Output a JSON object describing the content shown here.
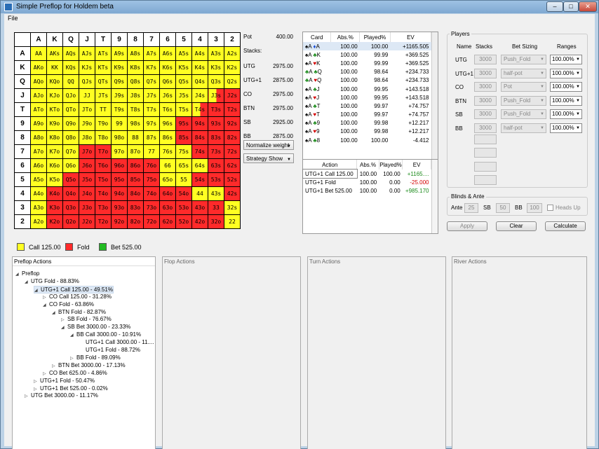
{
  "window": {
    "title": "Simple Preflop for Holdem beta",
    "min": "–",
    "max": "□",
    "close": "✕"
  },
  "menu": {
    "file": "File"
  },
  "hand_matrix": {
    "headers": [
      "A",
      "K",
      "Q",
      "J",
      "T",
      "9",
      "8",
      "7",
      "6",
      "5",
      "4",
      "3",
      "2"
    ],
    "rows": [
      [
        "AA",
        "AKs",
        "AQs",
        "AJs",
        "ATs",
        "A9s",
        "A8s",
        "A7s",
        "A6s",
        "A5s",
        "A4s",
        "A3s",
        "A2s"
      ],
      [
        "AKo",
        "KK",
        "KQs",
        "KJs",
        "KTs",
        "K9s",
        "K8s",
        "K7s",
        "K6s",
        "K5s",
        "K4s",
        "K3s",
        "K2s"
      ],
      [
        "AQo",
        "KQo",
        "QQ",
        "QJs",
        "QTs",
        "Q9s",
        "Q8s",
        "Q7s",
        "Q6s",
        "Q5s",
        "Q4s",
        "Q3s",
        "Q2s"
      ],
      [
        "AJo",
        "KJo",
        "QJo",
        "JJ",
        "JTs",
        "J9s",
        "J8s",
        "J7s",
        "J6s",
        "J5s",
        "J4s",
        "J3s",
        "J2s"
      ],
      [
        "ATo",
        "KTo",
        "QTo",
        "JTo",
        "TT",
        "T9s",
        "T8s",
        "T7s",
        "T6s",
        "T5s",
        "T4s",
        "T3s",
        "T2s"
      ],
      [
        "A9o",
        "K9o",
        "Q9o",
        "J9o",
        "T9o",
        "99",
        "98s",
        "97s",
        "96s",
        "95s",
        "94s",
        "93s",
        "92s"
      ],
      [
        "A8o",
        "K8o",
        "Q8o",
        "J8o",
        "T8o",
        "98o",
        "88",
        "87s",
        "86s",
        "85s",
        "84s",
        "83s",
        "82s"
      ],
      [
        "A7o",
        "K7o",
        "Q7o",
        "J7o",
        "T7o",
        "97o",
        "87o",
        "77",
        "76s",
        "75s",
        "74s",
        "73s",
        "72s"
      ],
      [
        "A6o",
        "K6o",
        "Q6o",
        "J6o",
        "T6o",
        "96o",
        "86o",
        "76o",
        "66",
        "65s",
        "64s",
        "63s",
        "62s"
      ],
      [
        "A5o",
        "K5o",
        "Q5o",
        "J5o",
        "T5o",
        "95o",
        "85o",
        "75o",
        "65o",
        "55",
        "54s",
        "53s",
        "52s"
      ],
      [
        "A4o",
        "K4o",
        "Q4o",
        "J4o",
        "T4o",
        "94o",
        "84o",
        "74o",
        "64o",
        "54o",
        "44",
        "43s",
        "42s"
      ],
      [
        "A3o",
        "K3o",
        "Q3o",
        "J3o",
        "T3o",
        "93o",
        "83o",
        "73o",
        "63o",
        "53o",
        "43o",
        "33",
        "32s"
      ],
      [
        "A2o",
        "K2o",
        "Q2o",
        "J2o",
        "T2o",
        "92o",
        "82o",
        "72o",
        "62o",
        "52o",
        "42o",
        "32o",
        "22"
      ]
    ],
    "colors": [
      "ccccccccccccc",
      "ccccccccccccc",
      "ccccccccccccc",
      "cccccccccccsf",
      "ccccccccccsff",
      "cccccccccffff",
      "cccccccccffff",
      "cccffcccccfff",
      "cccfffffcccff",
      "ccffffffccfff",
      "cfffffffffccf",
      "cfffffffffffc",
      "cfffffffffffc"
    ],
    "call_color": "#ffff22",
    "fold_color": "#ff2a2a",
    "bet_color": "#22bb22"
  },
  "legend": [
    {
      "label": "Call 125.00",
      "color": "#ffff22"
    },
    {
      "label": "Fold",
      "color": "#ff2a2a"
    },
    {
      "label": "Bet 525.00",
      "color": "#22bb22"
    }
  ],
  "pot": {
    "label": "Pot",
    "value": "400.00",
    "stacks_label": "Stacks:"
  },
  "stacks": [
    {
      "pos": "UTG",
      "value": "2975.00"
    },
    {
      "pos": "UTG+1",
      "value": "2875.00"
    },
    {
      "pos": "CO",
      "value": "2975.00"
    },
    {
      "pos": "BTN",
      "value": "2975.00"
    },
    {
      "pos": "SB",
      "value": "2925.00"
    },
    {
      "pos": "BB",
      "value": "2875.00"
    }
  ],
  "normalize_select": "Normalize weight",
  "strategy_select": "Strategy Show",
  "card_table": {
    "headers": [
      "Card",
      "Abs.%",
      "Played%",
      "EV"
    ],
    "rows": [
      {
        "card": "♠A ♦A",
        "abs": "100.00",
        "played": "100.00",
        "ev": "+1165.505"
      },
      {
        "card": "♠A ♣K",
        "abs": "100.00",
        "played": "99.99",
        "ev": "+369.525"
      },
      {
        "card": "♠A ♥K",
        "abs": "100.00",
        "played": "99.99",
        "ev": "+369.525"
      },
      {
        "card": "♣A ♣Q",
        "abs": "100.00",
        "played": "98.64",
        "ev": "+234.733"
      },
      {
        "card": "♣A ♥Q",
        "abs": "100.00",
        "played": "98.64",
        "ev": "+234.733"
      },
      {
        "card": "♠A ♣J",
        "abs": "100.00",
        "played": "99.95",
        "ev": "+143.518"
      },
      {
        "card": "♠A ♥J",
        "abs": "100.00",
        "played": "99.95",
        "ev": "+143.518"
      },
      {
        "card": "♠A ♣T",
        "abs": "100.00",
        "played": "99.97",
        "ev": "+74.757"
      },
      {
        "card": "♠A ♥T",
        "abs": "100.00",
        "played": "99.97",
        "ev": "+74.757"
      },
      {
        "card": "♠A ♣9",
        "abs": "100.00",
        "played": "99.98",
        "ev": "+12.217"
      },
      {
        "card": "♠A ♥9",
        "abs": "100.00",
        "played": "99.98",
        "ev": "+12.217"
      },
      {
        "card": "♠A ♣8",
        "abs": "100.00",
        "played": "100.00",
        "ev": "-4.412"
      }
    ]
  },
  "action_table": {
    "headers": [
      "Action",
      "Abs.%",
      "Played%",
      "EV"
    ],
    "rows": [
      {
        "action": "UTG+1 Call 125.00",
        "abs": "100.00",
        "played": "100.00",
        "ev": "+1165....",
        "evc": "#1a8a1a"
      },
      {
        "action": "UTG+1 Fold",
        "abs": "100.00",
        "played": "0.00",
        "ev": "-25.000",
        "evc": "#d40000"
      },
      {
        "action": "UTG+1 Bet 525.00",
        "abs": "100.00",
        "played": "0.00",
        "ev": "+985.170",
        "evc": "#1a8a1a"
      }
    ]
  },
  "players": {
    "group_label": "Players",
    "headers": [
      "Name",
      "Stacks",
      "Bet Sizing",
      "Ranges"
    ],
    "rows": [
      {
        "name": "UTG",
        "stack": "3000",
        "sizing": "Push_Fold",
        "range": "100.00%"
      },
      {
        "name": "UTG+1",
        "stack": "3000",
        "sizing": "half-pot",
        "range": "100.00%"
      },
      {
        "name": "CO",
        "stack": "3000",
        "sizing": "Pot",
        "range": "100.00%"
      },
      {
        "name": "BTN",
        "stack": "3000",
        "sizing": "Push_Fold",
        "range": "100.00%"
      },
      {
        "name": "SB",
        "stack": "3000",
        "sizing": "Push_Fold",
        "range": "100.00%"
      },
      {
        "name": "BB",
        "stack": "3000",
        "sizing": "half-pot",
        "range": "100.00%"
      }
    ]
  },
  "blinds": {
    "group_label": "Blinds & Ante",
    "ante_label": "Ante",
    "ante": "25",
    "sb_label": "SB",
    "sb": "50",
    "bb_label": "BB",
    "bb": "100",
    "heads_up": "Heads Up"
  },
  "buttons": {
    "apply": "Apply",
    "clear": "Clear",
    "calculate": "Calculate"
  },
  "panels": {
    "preflop": "Preflop Actions",
    "flop": "Flop Actions",
    "turn": "Turn Actions",
    "river": "River Actions"
  },
  "tree": [
    {
      "text": "Preflop",
      "indent": 0,
      "icon": "◢"
    },
    {
      "text": "UTG Fold - 88.83%",
      "indent": 1,
      "icon": "◢"
    },
    {
      "text": "UTG+1 Call 125.00 - 49.51%",
      "indent": 2,
      "icon": "◢",
      "selected": true
    },
    {
      "text": "CO Call 125.00 - 31.28%",
      "indent": 3,
      "icon": "▷"
    },
    {
      "text": "CO Fold - 63.86%",
      "indent": 3,
      "icon": "◢"
    },
    {
      "text": "BTN Fold - 82.87%",
      "indent": 4,
      "icon": "◢"
    },
    {
      "text": "SB Fold - 76.67%",
      "indent": 5,
      "icon": "▷"
    },
    {
      "text": "SB Bet 3000.00 - 23.33%",
      "indent": 5,
      "icon": "◢"
    },
    {
      "text": "BB Call 3000.00 - 10.91%",
      "indent": 6,
      "icon": "◢"
    },
    {
      "text": "UTG+1 Call 3000.00 - 11....",
      "indent": 7,
      "icon": ""
    },
    {
      "text": "UTG+1 Fold - 88.72%",
      "indent": 7,
      "icon": ""
    },
    {
      "text": "BB Fold - 89.09%",
      "indent": 6,
      "icon": "▷"
    },
    {
      "text": "BTN Bet 3000.00 - 17.13%",
      "indent": 4,
      "icon": "▷"
    },
    {
      "text": "CO Bet 625.00 - 4.86%",
      "indent": 3,
      "icon": "▷"
    },
    {
      "text": "UTG+1 Fold - 50.47%",
      "indent": 2,
      "icon": "▷"
    },
    {
      "text": "UTG+1 Bet 525.00 - 0.02%",
      "indent": 2,
      "icon": "▷"
    },
    {
      "text": "UTG Bet 3000.00 - 11.17%",
      "indent": 1,
      "icon": "▷"
    }
  ]
}
